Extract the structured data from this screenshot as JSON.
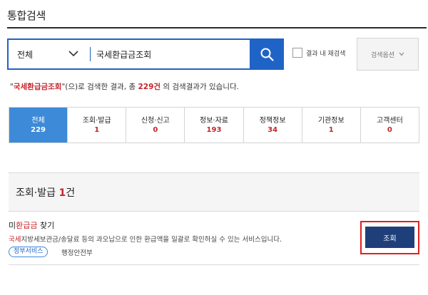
{
  "page": {
    "title": "통합검색"
  },
  "search": {
    "scope": "전체",
    "query": "국세환급금조회",
    "re_search_label": "결과 내 재검색",
    "options_label": "검색옵션"
  },
  "summary": {
    "keyword": "국세환급금조회",
    "part1": "\"",
    "part2": "\"(으)로 검색한 결과, 총 ",
    "count": "229건",
    "part3": " 의 검색결과가 있습니다."
  },
  "tabs": [
    {
      "label": "전체",
      "count": "229"
    },
    {
      "label": "조회·발급",
      "count": "1"
    },
    {
      "label": "신청·신고",
      "count": "0"
    },
    {
      "label": "정보·자료",
      "count": "193"
    },
    {
      "label": "정책정보",
      "count": "34"
    },
    {
      "label": "기관정보",
      "count": "1"
    },
    {
      "label": "고객센터",
      "count": "0"
    }
  ],
  "section": {
    "title": "조회·발급",
    "count": "1",
    "unit": "건"
  },
  "result": {
    "title_pre": "미",
    "title_hl": "환급금",
    "title_post": " 찾기",
    "desc_hl": "국세",
    "desc_rest": "지방세보관금/송달료 등의 과오납으로 인한 환급액을 일괄로 확인하실 수 있는 서비스입니다.",
    "tag": "정부서비스",
    "agency": "행정안전부",
    "button_label": "조회"
  },
  "colors": {
    "brand_blue": "#1f63c6",
    "active_tab": "#3d8ad8",
    "highlight_red": "#c4242b",
    "lookup_button": "#1e3f7a",
    "annotation_frame": "#e3201f"
  },
  "icons": {
    "scope_chevron": "chevron-down-icon",
    "search": "search-icon",
    "options_chevron": "chevron-down-icon"
  }
}
